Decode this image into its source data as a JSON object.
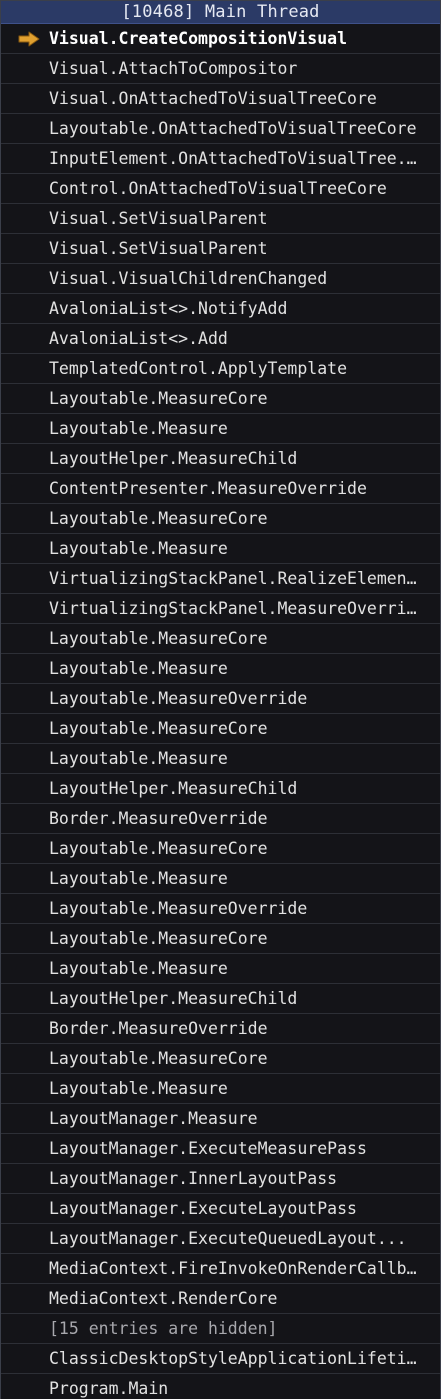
{
  "header": {
    "title": "[10468] Main Thread"
  },
  "colors": {
    "header_bg": "#2b3a66",
    "arrow": "#e0a030",
    "row_text": "#e2e2e2"
  },
  "icons": {
    "current_frame": "current-frame-arrow-icon"
  },
  "frames": [
    {
      "label": "Visual.CreateCompositionVisual",
      "current": true
    },
    {
      "label": "Visual.AttachToCompositor"
    },
    {
      "label": "Visual.OnAttachedToVisualTreeCore"
    },
    {
      "label": "Layoutable.OnAttachedToVisualTreeCore"
    },
    {
      "label": "InputElement.OnAttachedToVisualTree..."
    },
    {
      "label": "Control.OnAttachedToVisualTreeCore"
    },
    {
      "label": "Visual.SetVisualParent"
    },
    {
      "label": "Visual.SetVisualParent"
    },
    {
      "label": "Visual.VisualChildrenChanged"
    },
    {
      "label": "AvaloniaList<>.NotifyAdd"
    },
    {
      "label": "AvaloniaList<>.Add"
    },
    {
      "label": "TemplatedControl.ApplyTemplate"
    },
    {
      "label": "Layoutable.MeasureCore"
    },
    {
      "label": "Layoutable.Measure"
    },
    {
      "label": "LayoutHelper.MeasureChild"
    },
    {
      "label": "ContentPresenter.MeasureOverride"
    },
    {
      "label": "Layoutable.MeasureCore"
    },
    {
      "label": "Layoutable.Measure"
    },
    {
      "label": "VirtualizingStackPanel.RealizeElements"
    },
    {
      "label": "VirtualizingStackPanel.MeasureOverride"
    },
    {
      "label": "Layoutable.MeasureCore"
    },
    {
      "label": "Layoutable.Measure"
    },
    {
      "label": "Layoutable.MeasureOverride"
    },
    {
      "label": "Layoutable.MeasureCore"
    },
    {
      "label": "Layoutable.Measure"
    },
    {
      "label": "LayoutHelper.MeasureChild"
    },
    {
      "label": "Border.MeasureOverride"
    },
    {
      "label": "Layoutable.MeasureCore"
    },
    {
      "label": "Layoutable.Measure"
    },
    {
      "label": "Layoutable.MeasureOverride"
    },
    {
      "label": "Layoutable.MeasureCore"
    },
    {
      "label": "Layoutable.Measure"
    },
    {
      "label": "LayoutHelper.MeasureChild"
    },
    {
      "label": "Border.MeasureOverride"
    },
    {
      "label": "Layoutable.MeasureCore"
    },
    {
      "label": "Layoutable.Measure"
    },
    {
      "label": "LayoutManager.Measure"
    },
    {
      "label": "LayoutManager.ExecuteMeasurePass"
    },
    {
      "label": "LayoutManager.InnerLayoutPass"
    },
    {
      "label": "LayoutManager.ExecuteLayoutPass"
    },
    {
      "label": "LayoutManager.ExecuteQueuedLayout..."
    },
    {
      "label": "MediaContext.FireInvokeOnRenderCallb..."
    },
    {
      "label": "MediaContext.RenderCore"
    },
    {
      "label": "[15 entries are hidden]",
      "hidden": true
    },
    {
      "label": "ClassicDesktopStyleApplicationLifetim..."
    },
    {
      "label": "Program.Main"
    }
  ]
}
